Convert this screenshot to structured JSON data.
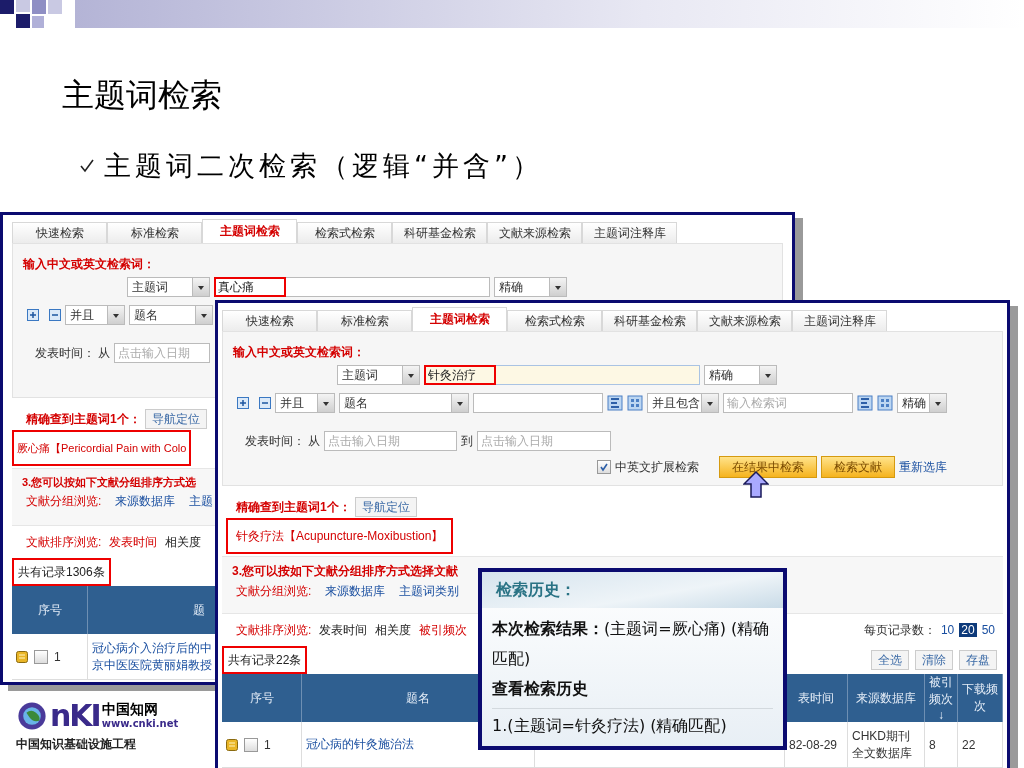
{
  "slide": {
    "title": "主题词检索",
    "bullet": "主题词二次检索（逻辑“并含”）"
  },
  "logo": {
    "mark": "nKI",
    "name": "中国知网",
    "url": "www.cnki.net",
    "tagline": "中国知识基础设施工程"
  },
  "screenshot_1": {
    "tabs": [
      {
        "label": "快速检索",
        "selected": false
      },
      {
        "label": "标准检索",
        "selected": false
      },
      {
        "label": "主题词检索",
        "selected": true
      },
      {
        "label": "检索式检索",
        "selected": false
      },
      {
        "label": "科研基金检索",
        "selected": false
      },
      {
        "label": "文献来源检索",
        "selected": false
      },
      {
        "label": "主题词注释库",
        "selected": false
      }
    ],
    "prompt": "输入中文或英文检索词：",
    "field_select": "主题词",
    "query": {
      "value": "真心痛",
      "highlighted": true,
      "focused": false
    },
    "match_select": "精确",
    "logic_select": "并且",
    "field_select_2": "题名",
    "date_label": "发表时间： 从",
    "date_placeholder": "点击输入日期",
    "found_label": "精确查到主题词1个：",
    "nav_button": "导航定位",
    "found_term": {
      "text": "厥心痛【Pericordial Pain with Colo",
      "highlighted": true
    },
    "group_heading": "3.您可以按如下文献分组排序方式选",
    "group_label": "文献分组浏览:",
    "group_links": [
      "来源数据库",
      "主题"
    ],
    "sort_label": "文献排序浏览:",
    "sort_options": [
      {
        "label": "发表时间",
        "selected": true
      },
      {
        "label": "相关度",
        "selected": false
      }
    ],
    "total": {
      "text": "共有记录1306条",
      "highlighted": true
    },
    "columns": [
      "序号",
      "题"
    ],
    "rows": [
      {
        "index": "1",
        "checked": false,
        "title_lines": [
          "冠心病介入治疗后的中",
          "京中医医院黄丽娟教授"
        ]
      }
    ]
  },
  "screenshot_2": {
    "tabs": [
      {
        "label": "快速检索",
        "selected": false
      },
      {
        "label": "标准检索",
        "selected": false
      },
      {
        "label": "主题词检索",
        "selected": true
      },
      {
        "label": "检索式检索",
        "selected": false
      },
      {
        "label": "科研基金检索",
        "selected": false
      },
      {
        "label": "文献来源检索",
        "selected": false
      },
      {
        "label": "主题词注释库",
        "selected": false
      }
    ],
    "prompt": "输入中文或英文检索词：",
    "field_select": "主题词",
    "query": {
      "value": "针灸治疗",
      "highlighted": true,
      "focused": true
    },
    "match_select": "精确",
    "logic_select": "并且",
    "field_select_2": "题名",
    "row2_extra": {
      "logic": "并且包含",
      "placeholder": "输入检索词",
      "match": "精确"
    },
    "date_label": "发表时间： 从",
    "date_placeholder": "点击输入日期",
    "date_to_label": "到",
    "date_to_placeholder": "点击输入日期",
    "extension": {
      "label": "中英文扩展检索",
      "checked": true
    },
    "buttons": [
      "在结果中检索",
      "检索文献"
    ],
    "reset_link": "重新选库",
    "found_label": "精确查到主题词1个：",
    "nav_button": "导航定位",
    "found_term": {
      "text": "针灸疗法【Acupuncture-Moxibustion】",
      "highlighted": true
    },
    "group_heading": "3.您可以按如下文献分组排序方式选择文献",
    "group_label": "文献分组浏览:",
    "group_links": [
      "来源数据库",
      "主题词类别"
    ],
    "sort_label": "文献排序浏览:",
    "sort_options": [
      {
        "label": "发表时间",
        "selected": false
      },
      {
        "label": "相关度",
        "selected": false
      },
      {
        "label": "被引频次",
        "selected": true
      }
    ],
    "page_size_label": "每页记录数：",
    "page_sizes": [
      {
        "label": "10",
        "selected": false
      },
      {
        "label": "20",
        "selected": true
      },
      {
        "label": "50",
        "selected": false
      }
    ],
    "total": {
      "text": "共有记录22条",
      "highlighted": true
    },
    "actions": [
      "全选",
      "清除",
      "存盘"
    ],
    "columns": [
      "序号",
      "题名",
      "表时间",
      "来源数据库",
      "被引频次↓",
      "下载频次"
    ],
    "rows": [
      {
        "index": "1",
        "checked": false,
        "title": "冠心病的针灸施治法",
        "date": "82-08-29",
        "source": "CHKD期刊全文数据库",
        "cited": "8",
        "downloads": "22"
      }
    ]
  },
  "history_popup": {
    "title": "检索历史：",
    "current": "**本次检索结果：**(主题词=厥心痛) (精确匹配)",
    "history_heading": "查看检索历史",
    "history": [
      "1.(主题词=针灸疗法) (精确匹配)"
    ]
  }
}
